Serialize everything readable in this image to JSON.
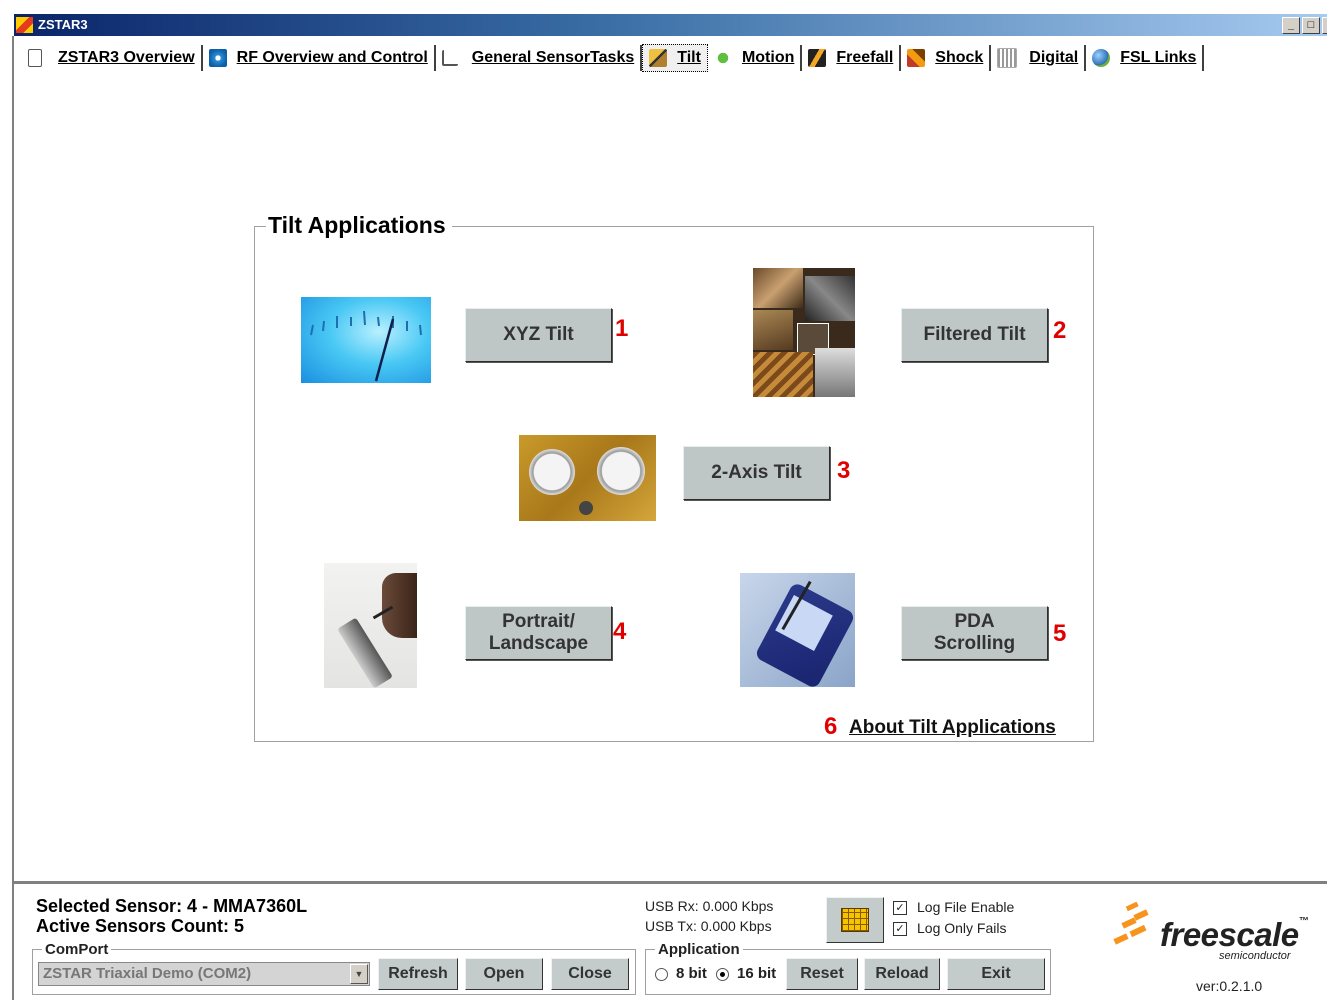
{
  "window": {
    "title": "ZSTAR3",
    "minimize": "_",
    "maximize": "□",
    "close": "×"
  },
  "tabs": [
    {
      "label": "ZSTAR3 Overview",
      "icon": "document-icon"
    },
    {
      "label": "RF Overview and Control",
      "icon": "antenna-icon"
    },
    {
      "label": "General SensorTasks",
      "icon": "chart-icon"
    },
    {
      "label": "Tilt",
      "icon": "tilt-icon",
      "active": true
    },
    {
      "label": "Motion",
      "icon": "motion-icon"
    },
    {
      "label": "Freefall",
      "icon": "freefall-icon"
    },
    {
      "label": "Shock",
      "icon": "shock-icon"
    },
    {
      "label": "Digital",
      "icon": "digital-icon"
    },
    {
      "label": "FSL Links",
      "icon": "globe-icon"
    }
  ],
  "main": {
    "group_title": "Tilt Applications",
    "apps": [
      {
        "label": "XYZ Tilt",
        "number": "1",
        "image": "gauge-needle-image"
      },
      {
        "label": "Filtered Tilt",
        "number": "2",
        "image": "collage-image"
      },
      {
        "label": "2-Axis Tilt",
        "number": "3",
        "image": "pressure-gauges-image"
      },
      {
        "label_line1": "Portrait/",
        "label_line2": "Landscape",
        "number": "4",
        "image": "handheld-device-image"
      },
      {
        "label_line1": "PDA",
        "label_line2": "Scrolling",
        "number": "5",
        "image": "pda-image"
      }
    ],
    "about_number": "6",
    "about_label": "About Tilt Applications"
  },
  "bottom": {
    "selected_sensor": "Selected Sensor: 4 - MMA7360L",
    "active_count": "Active Sensors Count: 5",
    "comport": {
      "legend": "ComPort",
      "value": "ZSTAR Triaxial Demo (COM2)",
      "refresh": "Refresh",
      "open": "Open",
      "close": "Close"
    },
    "usb_rx": "USB Rx:  0.000 Kbps",
    "usb_tx": "USB Tx:  0.000 Kbps",
    "application": {
      "legend": "Application",
      "bit8": "8 bit",
      "bit16": "16 bit",
      "selected": "16 bit",
      "reset": "Reset",
      "reload": "Reload",
      "exit": "Exit"
    },
    "log_file_enable": "Log File Enable",
    "log_only_fails": "Log Only Fails",
    "log_file_enable_checked": true,
    "log_only_fails_checked": true,
    "brand": "freescale",
    "brand_tm": "™",
    "brand_sub": "semiconductor",
    "version": "ver:0.2.1.0"
  },
  "colors": {
    "accent_number": "#e00000",
    "button_face": "#bfc6c6",
    "brand_orange": "#f7941d"
  }
}
